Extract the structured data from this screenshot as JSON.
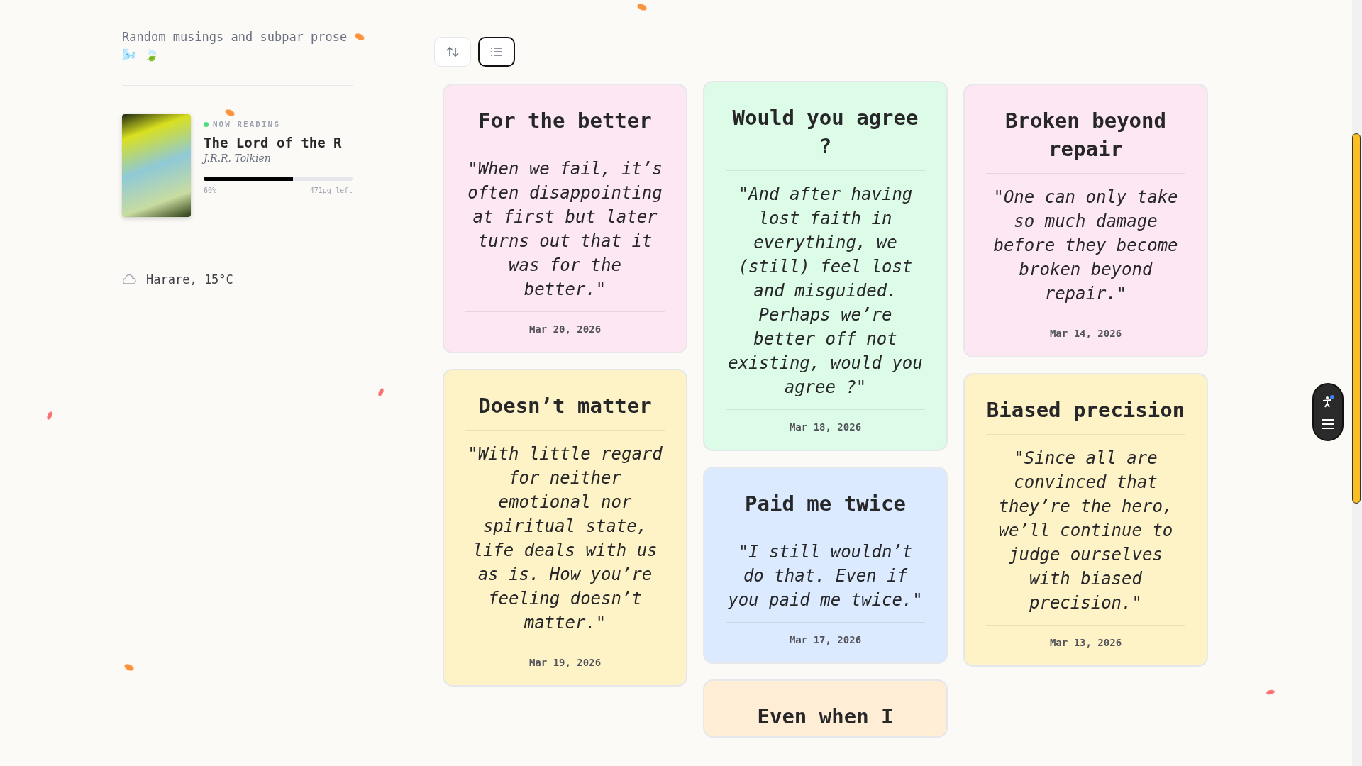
{
  "sidebar": {
    "tagline": "Random musings and subpar prose 🌬️ 🍃",
    "now_reading": {
      "label": "NOW READING",
      "title": "The Lord of the R",
      "author": "J.R.R. Tolkien",
      "level": 0.6,
      "percent": "60%",
      "pages_left": "471pg left"
    },
    "weather": {
      "text": "Harare, 15°C"
    }
  },
  "toolbar": {
    "buttons": [
      {
        "kind": "sort",
        "selected": false
      },
      {
        "kind": "list",
        "selected": true
      }
    ]
  },
  "columns": [
    [
      {
        "title": "For the better",
        "quote": "\"When we fail, it’s often disappointing at first but later turns out that it was for the better.\"",
        "date": "Mar 20, 2026",
        "color": "#fce7f3"
      },
      {
        "title": "Doesn’t matter",
        "quote": "\"With little regard for neither emotional nor spiritual state, life deals with us as is. How you’re feeling doesn’t matter.\"",
        "date": "Mar 19, 2026",
        "color": "#fef3c7"
      }
    ],
    [
      {
        "title": "Would you agree ?",
        "quote": "\"And after having lost faith in everything, we (still) feel lost and misguided. Perhaps we’re better off not existing, would you agree ?\"",
        "date": "Mar 18, 2026",
        "color": "#dcfce7"
      },
      {
        "title": "Paid me twice",
        "quote": "\"I still wouldn’t do that. Even if you paid me twice.\"",
        "date": "Mar 17, 2026",
        "color": "#dbeafe"
      },
      {
        "title": "Even when I",
        "color": "#ffedd5"
      }
    ],
    [
      {
        "title": "Broken beyond repair",
        "quote": "\"One can only take so much damage before they become broken beyond repair.\"",
        "date": "Mar 14, 2026",
        "color": "#fce7f3"
      },
      {
        "title": "Biased precision",
        "quote": "\"Since all are convinced that they’re the hero, we’ll continue to judge ourselves with biased precision.\"",
        "date": "Mar 13, 2026",
        "color": "#fef3c7"
      }
    ]
  ]
}
